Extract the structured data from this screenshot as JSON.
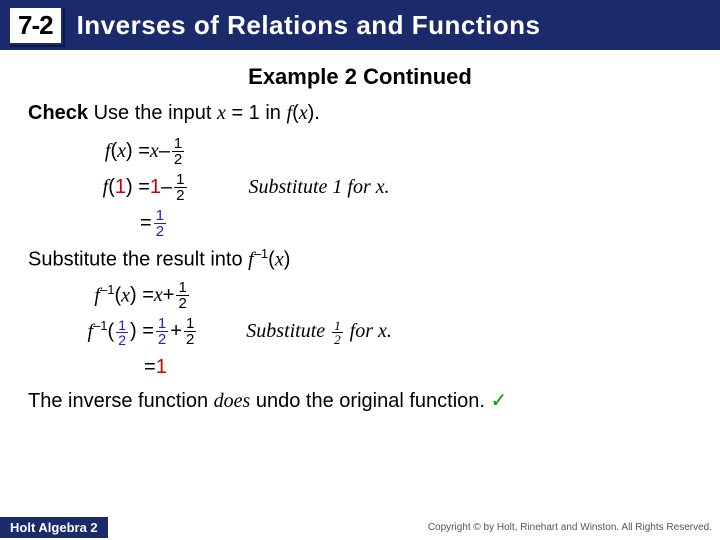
{
  "header": {
    "section": "7-2",
    "title": "Inverses of Relations and Functions"
  },
  "example_title": "Example 2 Continued",
  "check_label": "Check",
  "check_rest": " Use the input ",
  "check_var": "x",
  "check_eq": " = 1 in ",
  "check_fx": "f",
  "check_fx2": "x",
  "check_end": ").",
  "line1": {
    "lhs_f": "f",
    "lhs_x": "x",
    "eq": ") = ",
    "rhs_x": "x",
    "minus": " – ",
    "num": "1",
    "den": "2"
  },
  "line2": {
    "lhs_f": "f",
    "lhs_arg": "1",
    "eq": ") = ",
    "rhs_one": "1",
    "minus": " – ",
    "num": "1",
    "den": "2",
    "note_pre": "Substitute ",
    "note_val": "1",
    "note_post": " for x."
  },
  "line3": {
    "eq": "= ",
    "num": "1",
    "den": "2"
  },
  "subst_line": {
    "pre": "Substitute the result into  ",
    "f": "f",
    "sup": "–1",
    "x": "x",
    "end": ")"
  },
  "line4": {
    "f": "f",
    "sup": "–1",
    "x": "x",
    "eq": ") = ",
    "rhs_x": "x",
    "plus": " + ",
    "num": "1",
    "den": "2"
  },
  "line5": {
    "f": "f",
    "sup": "–1",
    "arg_num": "1",
    "arg_den": "2",
    "eq": ") = ",
    "r1n": "1",
    "r1d": "2",
    "plus": " + ",
    "r2n": "1",
    "r2d": "2",
    "note_pre": "Substitute ",
    "note_num": "1",
    "note_den": "2",
    "note_post": " for x."
  },
  "line6": {
    "eq": "= ",
    "val": "1"
  },
  "final": {
    "pre": "The inverse function ",
    "mid": "does",
    "post": " undo the original function. ",
    "check": "✓"
  },
  "footer": {
    "left": "Holt Algebra 2",
    "right": "Copyright © by Holt, Rinehart and Winston. All Rights Reserved."
  }
}
